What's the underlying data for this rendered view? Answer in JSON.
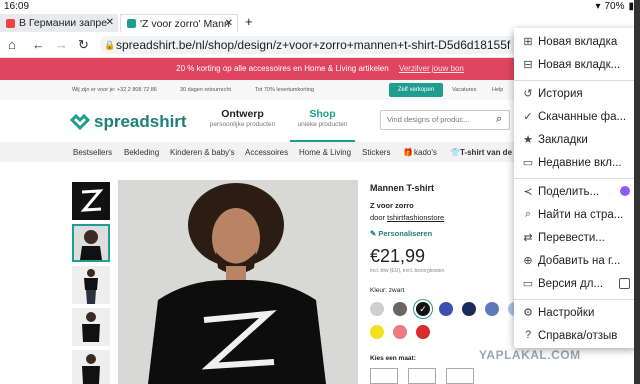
{
  "status": {
    "time": "16:09",
    "battery": "70%"
  },
  "tabs": [
    {
      "title": "В Германии запре",
      "favicon_color": "#e44"
    },
    {
      "title": "'Z voor zorro' Mann",
      "favicon_color": "#1d9e8f"
    }
  ],
  "new_tab_symbol": "+",
  "address": {
    "url": "spreadshirt.be/nl/shop/design/z+voor+zorro+mannen+t-shirt-D5d6d18155f"
  },
  "promo": {
    "text": "20 % korting op alle accessoires en Home & Living artikelen",
    "link": "Verzilver jouw bon"
  },
  "info": {
    "items": [
      "Wij zijn er voor je: +32 2 808 72 86",
      "30 dagen retourrecht",
      "Tot 70% levertumkorting"
    ],
    "zelf_button": "Zelf verkopen",
    "vacatures": "Vacatures",
    "help": "Help"
  },
  "header": {
    "logo": "spreadshirt",
    "nav": [
      {
        "title": "Ontwerp",
        "sub": "persoonlijke producten"
      },
      {
        "title": "Shop",
        "sub": "unieke producten"
      }
    ],
    "search_placeholder": "Vind designs of produc..."
  },
  "categories": [
    "Bestsellers",
    "Bekleding",
    "Kinderen & baby's",
    "Accessoires",
    "Home & Living",
    "Stickers",
    "kado's",
    "T-shirt van de w"
  ],
  "product": {
    "title": "Mannen T-shirt",
    "design": "Z voor zorro",
    "by_prefix": "door",
    "by_user": "tshirtfashionstore",
    "personalize": "Personaliseren",
    "price": "€21,99",
    "price_note": "Incl. btw (EU), excl. bezorgkosten",
    "color_label": "Kleur: zwart",
    "size_label": "Kies een maat:",
    "colors": [
      "#cfcfcf",
      "#666666",
      "#111111",
      "#3b4fb0",
      "#1b2a5a",
      "#5c79b8",
      "#a9c4e6",
      "#f2e21d",
      "#ef7c7c",
      "#d92b2b"
    ]
  },
  "menu": {
    "items": [
      {
        "label": "Новая вкладка",
        "icon": "plus-box-icon"
      },
      {
        "label": "Новая вкладк...",
        "icon": "incognito-icon"
      },
      {
        "label": "История",
        "icon": "history-icon"
      },
      {
        "label": "Скачанные фа...",
        "icon": "download-check-icon"
      },
      {
        "label": "Закладки",
        "icon": "star-icon"
      },
      {
        "label": "Недавние вкл...",
        "icon": "recent-tabs-icon"
      },
      {
        "label": "Поделить...",
        "icon": "share-icon"
      },
      {
        "label": "Найти на стра...",
        "icon": "find-in-page-icon"
      },
      {
        "label": "Перевести...",
        "icon": "translate-icon"
      },
      {
        "label": "Добавить на г...",
        "icon": "add-to-home-icon"
      },
      {
        "label": "Версия дл...",
        "icon": "desktop-site-icon"
      },
      {
        "label": "Настройки",
        "icon": "settings-icon"
      },
      {
        "label": "Справка/отзыв",
        "icon": "help-icon"
      }
    ]
  },
  "watermark": "YAPLAKAL.COM"
}
